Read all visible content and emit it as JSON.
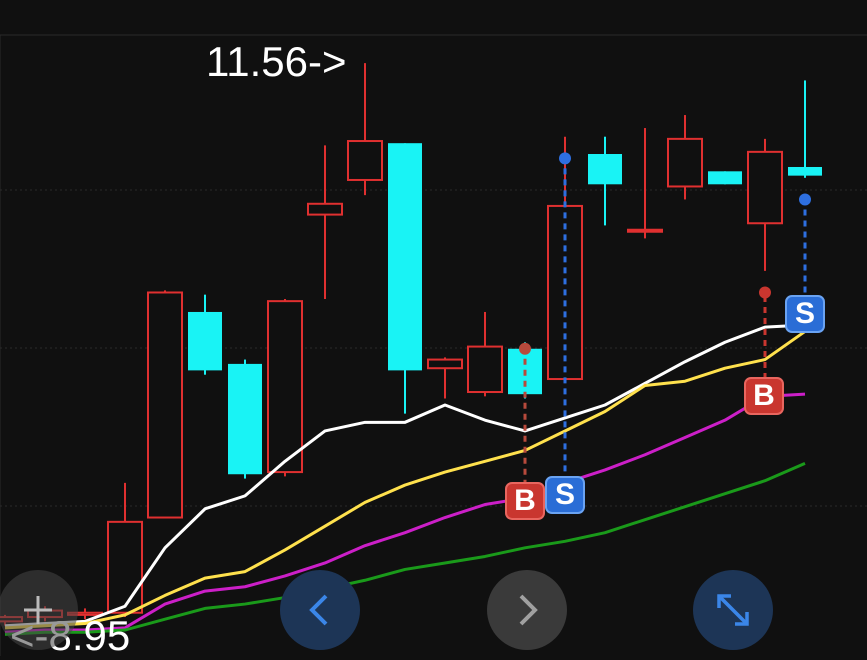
{
  "colors": {
    "background": "#101010",
    "grid": "#2a2a2a",
    "up": "#e03030",
    "down": "#19f3f5",
    "ma1": "#ffffff",
    "ma2": "#ffe14d",
    "ma3": "#cc1fc8",
    "ma4": "#1a9a1a",
    "buy_marker": "#c9362f",
    "sell_marker": "#2a6dd6"
  },
  "labels": {
    "high_marker": "11.56->",
    "low_marker": "<-8.95"
  },
  "markers": [
    {
      "type": "buy",
      "text": "B",
      "candle": 13
    },
    {
      "type": "sell",
      "text": "S",
      "candle": 14
    },
    {
      "type": "buy",
      "text": "B",
      "candle": 19
    },
    {
      "type": "sell",
      "text": "S",
      "candle": 20
    }
  ],
  "nav": {
    "prev_icon": "chevron-left-icon",
    "next_icon": "chevron-right-icon",
    "fullscreen_icon": "expand-icon"
  },
  "chart_data": {
    "type": "candlestick",
    "high": 11.56,
    "low": 8.95,
    "candles": [
      {
        "o": 8.98,
        "c": 9.0,
        "h": 9.01,
        "l": 8.96
      },
      {
        "o": 9.0,
        "c": 9.03,
        "h": 9.05,
        "l": 8.98
      },
      {
        "o": 9.01,
        "c": 9.02,
        "h": 9.04,
        "l": 8.99
      },
      {
        "o": 9.02,
        "c": 9.44,
        "h": 9.62,
        "l": 9.0
      },
      {
        "o": 9.46,
        "c": 10.5,
        "h": 10.51,
        "l": 9.46
      },
      {
        "o": 10.41,
        "c": 10.14,
        "h": 10.49,
        "l": 10.12
      },
      {
        "o": 10.17,
        "c": 9.66,
        "h": 10.19,
        "l": 9.64
      },
      {
        "o": 9.67,
        "c": 10.46,
        "h": 10.47,
        "l": 9.65
      },
      {
        "o": 10.86,
        "c": 10.91,
        "h": 11.18,
        "l": 10.47
      },
      {
        "o": 11.02,
        "c": 11.2,
        "h": 11.56,
        "l": 10.95
      },
      {
        "o": 11.19,
        "c": 10.14,
        "h": 11.19,
        "l": 9.94
      },
      {
        "o": 10.15,
        "c": 10.19,
        "h": 10.2,
        "l": 10.01
      },
      {
        "o": 10.04,
        "c": 10.25,
        "h": 10.41,
        "l": 10.02
      },
      {
        "o": 10.24,
        "c": 10.03,
        "h": 10.27,
        "l": 10.01
      },
      {
        "o": 10.1,
        "c": 10.9,
        "h": 11.22,
        "l": 10.1
      },
      {
        "o": 11.14,
        "c": 11.0,
        "h": 11.22,
        "l": 10.81
      },
      {
        "o": 10.79,
        "c": 10.79,
        "h": 11.26,
        "l": 10.75
      },
      {
        "o": 10.99,
        "c": 11.21,
        "h": 11.32,
        "l": 10.93
      },
      {
        "o": 11.06,
        "c": 11.0,
        "h": 11.06,
        "l": 11.0
      },
      {
        "o": 10.82,
        "c": 11.15,
        "h": 11.21,
        "l": 10.6
      },
      {
        "o": 11.08,
        "c": 11.04,
        "h": 11.48,
        "l": 11.03
      }
    ],
    "series": [
      {
        "values": [
          8.96,
          8.97,
          8.98,
          9.05,
          9.32,
          9.5,
          9.56,
          9.72,
          9.86,
          9.9,
          9.9,
          9.98,
          9.91,
          9.86,
          9.92,
          9.98,
          10.08,
          10.18,
          10.27,
          10.34,
          10.35
        ]
      },
      {
        "values": [
          8.95,
          8.96,
          8.97,
          9.01,
          9.1,
          9.18,
          9.21,
          9.31,
          9.42,
          9.53,
          9.61,
          9.67,
          9.72,
          9.77,
          9.86,
          9.95,
          10.07,
          10.09,
          10.15,
          10.19,
          10.32
        ]
      },
      {
        "values": [
          8.93,
          8.94,
          8.94,
          8.95,
          9.06,
          9.12,
          9.14,
          9.19,
          9.25,
          9.33,
          9.39,
          9.46,
          9.52,
          9.55,
          9.62,
          9.68,
          9.75,
          9.83,
          9.91,
          10.02,
          10.03
        ]
      },
      {
        "values": [
          8.92,
          8.93,
          8.93,
          8.94,
          8.99,
          9.04,
          9.06,
          9.09,
          9.13,
          9.17,
          9.22,
          9.25,
          9.28,
          9.32,
          9.35,
          9.39,
          9.45,
          9.51,
          9.57,
          9.63,
          9.71
        ]
      }
    ],
    "ylim": [
      8.82,
      11.69
    ]
  }
}
